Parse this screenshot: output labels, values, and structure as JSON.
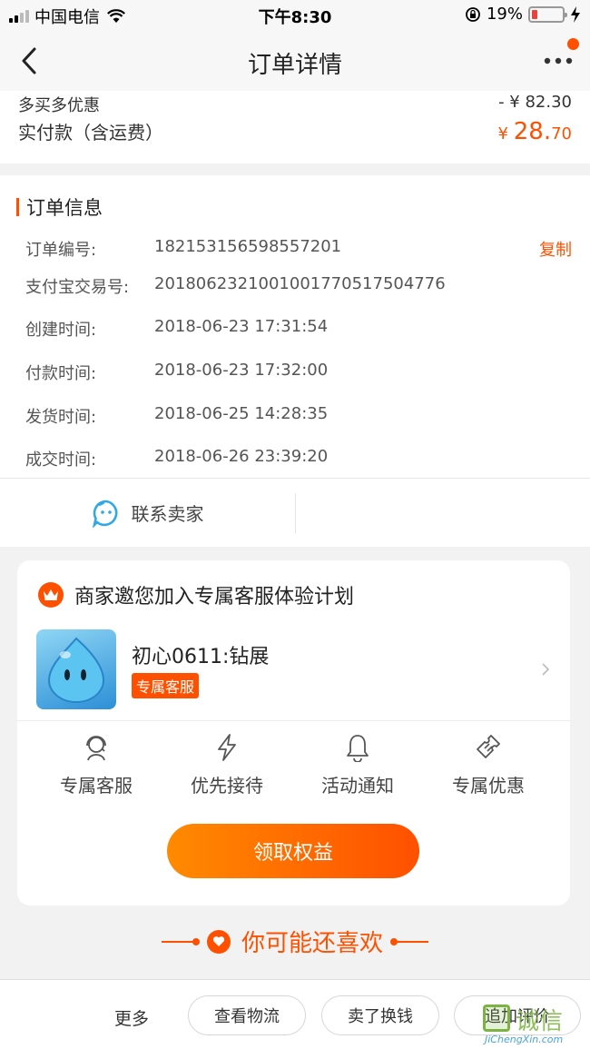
{
  "status_bar": {
    "carrier": "中国电信",
    "time": "下午8:30",
    "battery_percent": "19%",
    "battery_level": 0.19
  },
  "nav": {
    "title": "订单详情"
  },
  "price": {
    "discount_label": "多买多优惠",
    "discount_value": "- ¥ 82.30",
    "paid_label": "实付款（含运费）",
    "paid_currency": "¥ ",
    "paid_int": "28.",
    "paid_dec": "70"
  },
  "order_info": {
    "heading": "订单信息",
    "copy_label": "复制",
    "rows": [
      {
        "label": "订单编号:",
        "value": "182153156598557201"
      },
      {
        "label": "支付宝交易号:",
        "value": "2018062321001001770517504776"
      },
      {
        "label": "创建时间:",
        "value": "2018-06-23 17:31:54"
      },
      {
        "label": "付款时间:",
        "value": "2018-06-23 17:32:00"
      },
      {
        "label": "发货时间:",
        "value": "2018-06-25 14:28:35"
      },
      {
        "label": "成交时间:",
        "value": "2018-06-26 23:39:20"
      }
    ],
    "contact_label": "联系卖家"
  },
  "invite": {
    "title": "商家邀您加入专属客服体验计划",
    "shop_name": "初心0611:钻展",
    "badge": "专属客服",
    "perks": [
      {
        "icon": "headset-icon",
        "label": "专属客服"
      },
      {
        "icon": "lightning-icon",
        "label": "优先接待"
      },
      {
        "icon": "bell-icon",
        "label": "活动通知"
      },
      {
        "icon": "ticket-icon",
        "label": "专属优惠"
      }
    ],
    "claim_label": "领取权益"
  },
  "recommend": {
    "label": "你可能还喜欢"
  },
  "footer": {
    "more": "更多",
    "buttons": [
      "查看物流",
      "卖了换钱",
      "追加评价"
    ]
  },
  "watermark": {
    "cn": "诚信",
    "en": "JiChengXin.com"
  },
  "colors": {
    "accent": "#ff5000",
    "background": "#f2f2f2"
  }
}
